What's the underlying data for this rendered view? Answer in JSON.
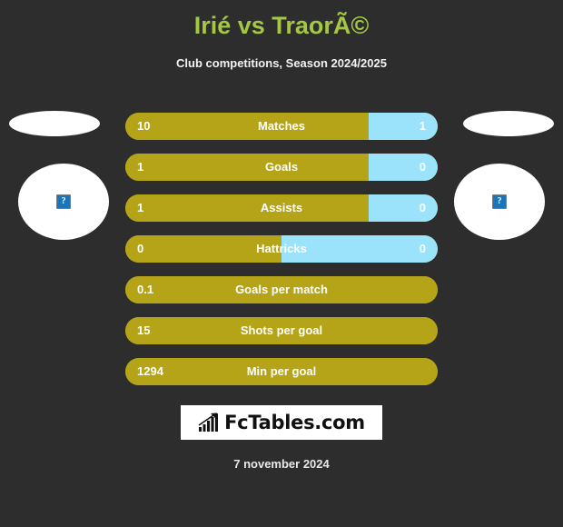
{
  "header": {
    "title": "Irié vs TraorÃ©",
    "subtitle": "Club competitions, Season 2024/2025",
    "title_color": "#a4c744"
  },
  "players": {
    "left": {
      "flag_placeholder": "flag-placeholder",
      "photo_placeholder": "photo-placeholder",
      "broken_image_glyph": "?"
    },
    "right": {
      "flag_placeholder": "flag-placeholder",
      "photo_placeholder": "photo-placeholder",
      "broken_image_glyph": "?"
    }
  },
  "colors": {
    "background": "#2d2d2d",
    "home_bar": "#b5a318",
    "away_bar": "#9be3fa",
    "text": "#ffffff"
  },
  "stats": [
    {
      "label": "Matches",
      "home": "10",
      "away": "1",
      "home_pct": 78,
      "two_sided": true
    },
    {
      "label": "Goals",
      "home": "1",
      "away": "0",
      "home_pct": 78,
      "two_sided": true
    },
    {
      "label": "Assists",
      "home": "1",
      "away": "0",
      "home_pct": 78,
      "two_sided": true
    },
    {
      "label": "Hattricks",
      "home": "0",
      "away": "0",
      "home_pct": 50,
      "two_sided": true
    },
    {
      "label": "Goals per match",
      "home": "0.1",
      "away": "",
      "home_pct": 100,
      "two_sided": false
    },
    {
      "label": "Shots per goal",
      "home": "15",
      "away": "",
      "home_pct": 100,
      "two_sided": false
    },
    {
      "label": "Min per goal",
      "home": "1294",
      "away": "",
      "home_pct": 100,
      "two_sided": false
    }
  ],
  "logo": {
    "text": "FcTables.com",
    "icon": "bar-chart-growth-icon"
  },
  "footer": {
    "date": "7 november 2024"
  }
}
